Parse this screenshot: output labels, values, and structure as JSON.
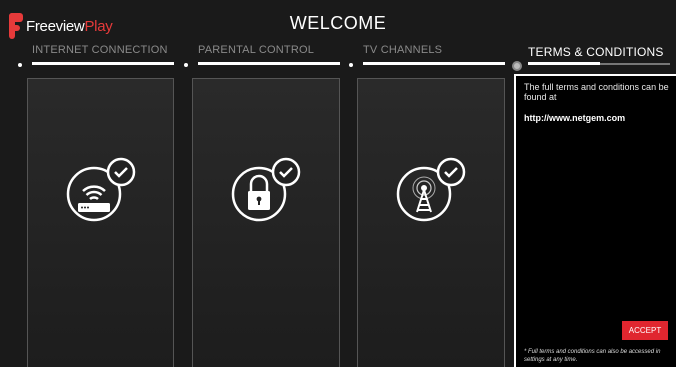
{
  "app": {
    "logo_text_1": "Freeview",
    "logo_text_2": "Play",
    "title": "WELCOME",
    "accent_color": "#e0262f"
  },
  "steps": [
    {
      "label": "INTERNET CONNECTION",
      "icon": "router-icon",
      "status": "check-icon"
    },
    {
      "label": "PARENTAL CONTROL",
      "icon": "padlock-icon",
      "status": "check-icon"
    },
    {
      "label": "TV CHANNELS",
      "icon": "antenna-icon",
      "status": "check-icon"
    },
    {
      "label": "TERMS & CONDITIONS",
      "active": true
    }
  ],
  "terms": {
    "text": "The full terms and conditions can be found at",
    "link": "http://www.netgem.com",
    "accept_label": "ACCEPT",
    "note": "* Full terms and conditions can also be accessed in settings at any time."
  }
}
